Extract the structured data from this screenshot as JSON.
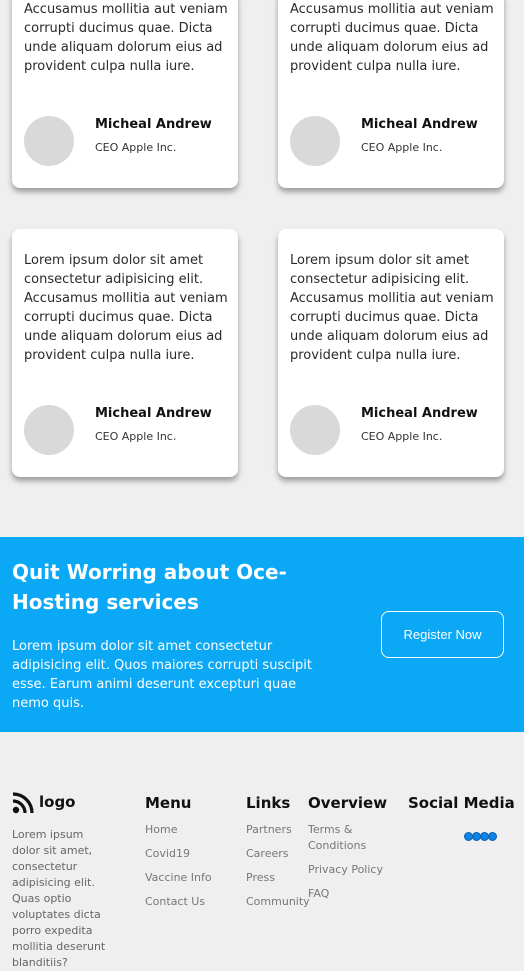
{
  "testimonials": [
    {
      "lines": [
        "Accusamus mollitia aut veniam",
        "corrupti ducimus quae. Dicta",
        "unde aliquam dolorum eius ad",
        "provident culpa nulla iure."
      ],
      "name": "Micheal Andrew",
      "role": "CEO Apple Inc."
    },
    {
      "lines": [
        "Accusamus mollitia aut veniam",
        "corrupti ducimus quae. Dicta",
        "unde aliquam dolorum eius ad",
        "provident culpa nulla iure."
      ],
      "name": "Micheal Andrew",
      "role": "CEO Apple Inc."
    },
    {
      "lines": [
        "Lorem ipsum dolor sit amet",
        "consectetur adipisicing elit.",
        "Accusamus mollitia aut veniam",
        "corrupti ducimus quae. Dicta",
        "unde aliquam dolorum eius ad",
        "provident culpa nulla iure."
      ],
      "name": "Micheal Andrew",
      "role": "CEO Apple Inc."
    },
    {
      "lines": [
        "Lorem ipsum dolor sit amet",
        "consectetur adipisicing elit.",
        "Accusamus mollitia aut veniam",
        "corrupti ducimus quae. Dicta",
        "unde aliquam dolorum eius ad",
        "provident culpa nulla iure."
      ],
      "name": "Micheal Andrew",
      "role": "CEO Apple Inc."
    }
  ],
  "cta": {
    "title_lines": [
      "Quit Worring about Oce-",
      "Hosting services"
    ],
    "text_lines": [
      "Lorem ipsum dolor sit amet consectetur",
      "adipisicing elit. Quos maiores corrupti suscipit",
      "esse. Earum animi deserunt excepturi quae",
      "nemo quis."
    ],
    "button_label": "Register Now"
  },
  "footer": {
    "logo_text": "logo",
    "logo_icon": "rss-icon",
    "about_lines": [
      "Lorem ipsum",
      "dolor sit amet,",
      "consectetur",
      "adipisicing elit.",
      "Quas optio",
      "voluptates dicta",
      "porro expedita",
      "mollitia deserunt",
      "blanditiis?"
    ],
    "menu": {
      "heading": "Menu",
      "links": [
        "Home",
        "Covid19",
        "Vaccine Info",
        "Contact Us"
      ]
    },
    "links": {
      "heading": "Links",
      "links": [
        "Partners",
        "Careers",
        "Press",
        "Community"
      ]
    },
    "overview": {
      "heading": "Overview",
      "links": [
        "Terms &",
        "Conditions",
        "Privacy Policy",
        "FAQ"
      ]
    },
    "social": {
      "heading": "Social Media",
      "icons": [
        "social-icon-1",
        "social-icon-2",
        "social-icon-3",
        "social-icon-4"
      ]
    }
  },
  "colors": {
    "background": "#efefef",
    "cta_blue": "#0aa8f5",
    "card": "#ffffff",
    "avatar": "#d9d9d9",
    "social_dot": "#0a84e6"
  }
}
